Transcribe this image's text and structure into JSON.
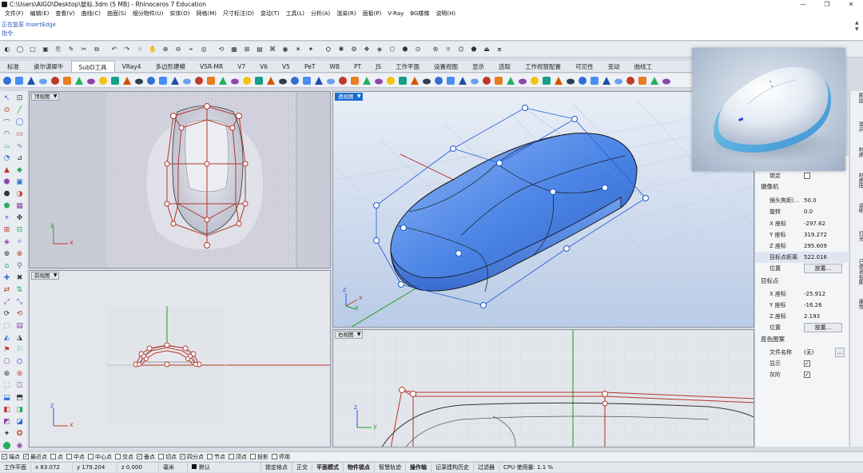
{
  "window": {
    "title": "C:\\Users\\AIGO\\Desktop\\鼠标.3dm (5 MB) - Rhinoceros 7 Education",
    "buttons": [
      "—",
      "❐",
      "✕"
    ]
  },
  "menu": [
    "文件(F)",
    "编辑(E)",
    "查看(V)",
    "曲线(C)",
    "曲面(S)",
    "细分物件(U)",
    "实体(O)",
    "网格(M)",
    "尺寸标注(D)",
    "变动(T)",
    "工具(L)",
    "分析(A)",
    "渲染(R)",
    "面板(P)",
    "V-Ray",
    "BG楼梯",
    "说明(H)"
  ],
  "command": {
    "history": "正在复原 InsertEdge",
    "prompt_label": "指令:",
    "value": ""
  },
  "tabs": [
    "标准",
    "桌尔谟犀牛",
    "SubD工具",
    "VRay4",
    "多边形建模",
    "VSR-MR",
    "V7",
    "V6",
    "V5",
    "PeT",
    "WB",
    "PT",
    "JS",
    "工作平面",
    "设置视图",
    "显示",
    "选取",
    "工作视窗配置",
    "可见性",
    "变动",
    "曲线工"
  ],
  "active_tab": "SubD工具",
  "viewports": {
    "top": {
      "label": "顶视图"
    },
    "perspective": {
      "label": "透视图"
    },
    "front": {
      "label": "前视图"
    },
    "right": {
      "label": "右视图"
    }
  },
  "axes": {
    "x": "x",
    "y": "y",
    "z": "z"
  },
  "properties": {
    "lock_label": "锁定",
    "camera_header": "摄像机",
    "lens_label": "镜头焦距(...",
    "lens_value": "50.0",
    "rotation_label": "旋转",
    "rotation_value": "0.0",
    "cam_x_label": "X 座标",
    "cam_x_value": "-297.62",
    "cam_y_label": "Y 座标",
    "cam_y_value": "319.272",
    "cam_z_label": "Z 座标",
    "cam_z_value": "295.609",
    "target_dist_label": "目标点距离",
    "target_dist_value": "522.016",
    "position_label": "位置",
    "place_button": "放置...",
    "target_header": "目标点",
    "tgt_x_label": "X 座标",
    "tgt_x_value": "-25.912",
    "tgt_y_label": "Y 座标",
    "tgt_y_value": "-16.26",
    "tgt_z_label": "Z 座标",
    "tgt_z_value": "2.193",
    "tgt_position_label": "位置",
    "tgt_place_button": "放置...",
    "bg_header": "底色图案",
    "file_label": "文件名称",
    "file_value": "(无)",
    "browse_button": "...",
    "show_label": "显示",
    "gray_label": "灰阶"
  },
  "side_tabs": [
    "图层",
    "显示",
    "材质",
    "材质库",
    "说明",
    "灯光",
    "已命名视图",
    "属性"
  ],
  "osnaps": [
    {
      "label": "端点",
      "checked": true
    },
    {
      "label": "最近点",
      "checked": true
    },
    {
      "label": "点",
      "checked": false
    },
    {
      "label": "中点",
      "checked": false
    },
    {
      "label": "中心点",
      "checked": false
    },
    {
      "label": "交点",
      "checked": false
    },
    {
      "label": "垂点",
      "checked": true
    },
    {
      "label": "切点",
      "checked": false
    },
    {
      "label": "四分点",
      "checked": true
    },
    {
      "label": "节点",
      "checked": false
    },
    {
      "label": "顶点",
      "checked": false
    },
    {
      "label": "投影",
      "checked": false
    },
    {
      "label": "停用",
      "checked": false
    }
  ],
  "status": {
    "cplane": "工作平面",
    "x": "x 83.072",
    "y": "y 179.204",
    "z": "z 0.000",
    "units": "毫米",
    "layer": "默认",
    "grid_snap": "锁定格点",
    "ortho": "正交",
    "planar": "平面模式",
    "osnap": "物件锁点",
    "smarttrack": "智慧轨迹",
    "gumball": "操作轴",
    "history": "记录建构历史",
    "filter": "过滤器",
    "cpu": "CPU 使用量: 1.1 %"
  },
  "colors": {
    "accent": "#1b6bd1",
    "model_blue": "#3f7fe0",
    "cage_red": "#c0392b"
  }
}
